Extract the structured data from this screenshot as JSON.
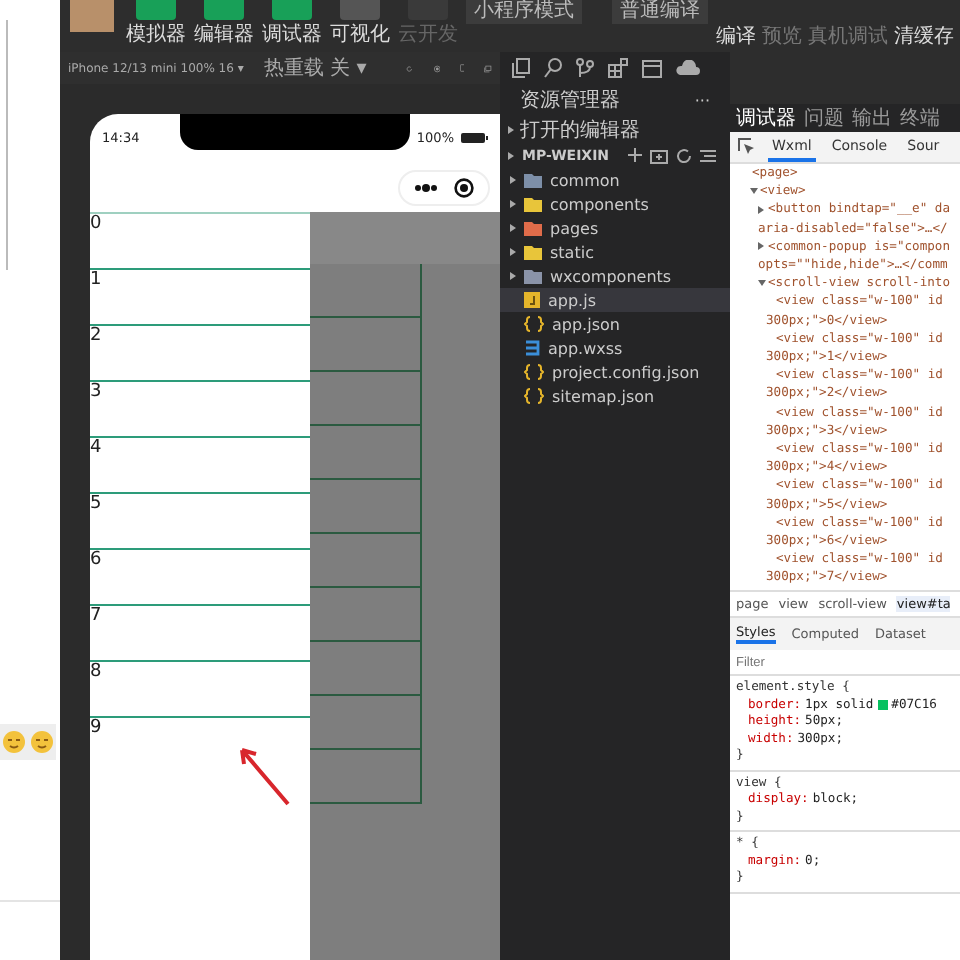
{
  "toolbar": {
    "modes": [
      {
        "label": "模拟器",
        "on": true,
        "disabled": false
      },
      {
        "label": "编辑器",
        "on": true,
        "disabled": false
      },
      {
        "label": "调试器",
        "on": true,
        "disabled": false
      },
      {
        "label": "可视化",
        "on": false,
        "disabled": false
      },
      {
        "label": "云开发",
        "on": false,
        "disabled": true
      }
    ],
    "mode_select": "小程序模式",
    "compile_select": "普通编译",
    "actions": [
      {
        "label": "编译",
        "disabled": false
      },
      {
        "label": "预览",
        "disabled": true
      },
      {
        "label": "真机调试",
        "disabled": true
      },
      {
        "label": "清缓存",
        "disabled": false
      }
    ]
  },
  "device_bar": {
    "device": "iPhone 12/13 mini 100% 16 ▾",
    "hot_reload": "热重载 关 ▾"
  },
  "phone": {
    "time": "14:34",
    "battery": "100%",
    "rows": [
      "0",
      "1",
      "2",
      "3",
      "4",
      "5",
      "6",
      "7",
      "8",
      "9"
    ]
  },
  "explorer": {
    "title": "资源管理器",
    "more": "···",
    "open_editors": "打开的编辑器",
    "project": "MP-WEIXIN",
    "files": [
      {
        "name": "common",
        "kind": "folder",
        "color": "#7d8fa8",
        "selected": false
      },
      {
        "name": "components",
        "kind": "folder",
        "color": "#e8c53a",
        "selected": false
      },
      {
        "name": "pages",
        "kind": "folder",
        "color": "#e06c4a",
        "selected": false
      },
      {
        "name": "static",
        "kind": "folder",
        "color": "#e8c53a",
        "selected": false
      },
      {
        "name": "wxcomponents",
        "kind": "folder",
        "color": "#8a93a8",
        "selected": false
      },
      {
        "name": "app.js",
        "kind": "js",
        "selected": true
      },
      {
        "name": "app.json",
        "kind": "json",
        "selected": false
      },
      {
        "name": "app.wxss",
        "kind": "wxss",
        "selected": false
      },
      {
        "name": "project.config.json",
        "kind": "json",
        "selected": false
      },
      {
        "name": "sitemap.json",
        "kind": "json",
        "selected": false
      }
    ]
  },
  "debugger": {
    "tabs": [
      {
        "label": "调试器",
        "selected": true
      },
      {
        "label": "问题",
        "selected": false
      },
      {
        "label": "输出",
        "selected": false
      },
      {
        "label": "终端",
        "selected": false
      }
    ],
    "devtools_tabs": [
      {
        "label": "Wxml",
        "selected": true
      },
      {
        "label": "Console",
        "selected": false
      },
      {
        "label": "Sour",
        "selected": false
      }
    ],
    "wxml": [
      {
        "lines": [
          "<page>"
        ],
        "children": [
          {
            "lines": [
              "<view>"
            ],
            "expanded": true,
            "children": [
              {
                "lines": [
                  "<button bindtap=\"__e\" da",
                  "aria-disabled=\"false\">…</"
                ],
                "expanded": false
              },
              {
                "lines": [
                  "<common-popup is=\"compon",
                  "opts=\"\"hide,hide\">…</comm"
                ],
                "expanded": false
              },
              {
                "lines": [
                  "<scroll-view scroll-into"
                ],
                "expanded": true,
                "children": [
                  {
                    "lines": [
                      "<view class=\"w-100\" id",
                      "300px;\">0</view>"
                    ]
                  },
                  {
                    "lines": [
                      "<view class=\"w-100\" id",
                      "300px;\">1</view>"
                    ]
                  },
                  {
                    "lines": [
                      "<view class=\"w-100\" id",
                      "300px;\">2</view>"
                    ]
                  },
                  {
                    "lines": [
                      "<view class=\"w-100\" id",
                      "300px;\">3</view>"
                    ]
                  },
                  {
                    "lines": [
                      "<view class=\"w-100\" id",
                      "300px;\">4</view>"
                    ]
                  },
                  {
                    "lines": [
                      "<view class=\"w-100\" id",
                      "300px;\">5</view>"
                    ]
                  },
                  {
                    "lines": [
                      "<view class=\"w-100\" id",
                      "300px;\">6</view>"
                    ]
                  },
                  {
                    "lines": [
                      "<view class=\"w-100\" id",
                      "300px;\">7</view>"
                    ]
                  }
                ]
              }
            ]
          }
        ]
      }
    ],
    "breadcrumb": [
      {
        "label": "page",
        "selected": false
      },
      {
        "label": "view",
        "selected": false
      },
      {
        "label": "scroll-view",
        "selected": false
      },
      {
        "label": "view#ta",
        "selected": true
      }
    ],
    "style_tabs": [
      {
        "label": "Styles",
        "selected": true
      },
      {
        "label": "Computed",
        "selected": false
      },
      {
        "label": "Dataset",
        "selected": false
      }
    ],
    "filter_placeholder": "Filter",
    "rules": [
      {
        "selector": "element.style {",
        "close": "}",
        "decls": [
          {
            "prop": "border:",
            "value": "1px solid",
            "color": "#07c160",
            "tail": "#07C16"
          },
          {
            "prop": "height:",
            "value": "50px;"
          },
          {
            "prop": "width:",
            "value": "300px;"
          }
        ]
      },
      {
        "selector": "view {",
        "close": "}",
        "decls": [
          {
            "prop": "display:",
            "value": "block;"
          }
        ]
      },
      {
        "selector": "* {",
        "close": "}",
        "decls": [
          {
            "prop": "margin:",
            "value": "0;"
          }
        ]
      }
    ]
  }
}
